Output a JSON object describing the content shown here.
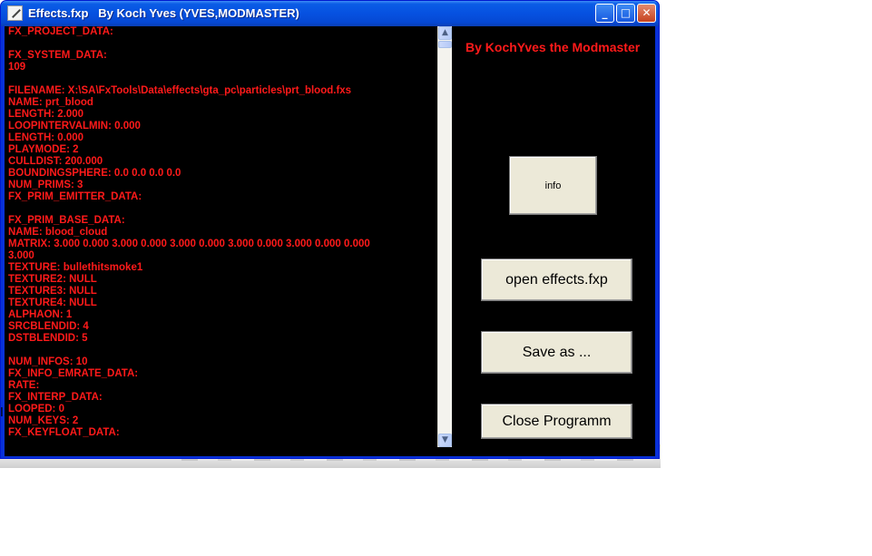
{
  "window": {
    "title": "Effects.fxp   By Koch Yves (YVES,MODMASTER)",
    "controls": {
      "minimize": "_",
      "maximize": "□",
      "close": "✕"
    }
  },
  "credit": "By KochYves the Modmaster",
  "editor_lines": [
    "FX_PROJECT_DATA:",
    "",
    "FX_SYSTEM_DATA:",
    "109",
    "",
    "FILENAME: X:\\SA\\FxTools\\Data\\effects\\gta_pc\\particles\\prt_blood.fxs",
    "NAME: prt_blood",
    "LENGTH: 2.000",
    "LOOPINTERVALMIN: 0.000",
    "LENGTH: 0.000",
    "PLAYMODE: 2",
    "CULLDIST: 200.000",
    "BOUNDINGSPHERE: 0.0 0.0 0.0 0.0",
    "NUM_PRIMS: 3",
    "FX_PRIM_EMITTER_DATA:",
    "",
    "FX_PRIM_BASE_DATA:",
    "NAME: blood_cloud",
    "MATRIX: 3.000 0.000 3.000 0.000 3.000 0.000 3.000 0.000 3.000 0.000 0.000",
    "3.000",
    "TEXTURE: bullethitsmoke1",
    "TEXTURE2: NULL",
    "TEXTURE3: NULL",
    "TEXTURE4: NULL",
    "ALPHAON: 1",
    "SRCBLENDID: 4",
    "DSTBLENDID: 5",
    "",
    "NUM_INFOS: 10",
    "FX_INFO_EMRATE_DATA:",
    "RATE:",
    "FX_INTERP_DATA:",
    "LOOPED: 0",
    "NUM_KEYS: 2",
    "FX_KEYFLOAT_DATA:"
  ],
  "scrollbar": {
    "up": "▲",
    "down": "▼"
  },
  "buttons": {
    "info": "info",
    "open": "open effects.fxp",
    "save": "Save as ...",
    "close": "Close Programm"
  },
  "colors": {
    "text": "#ff1a1a",
    "client_bg": "#000000",
    "button_face": "#ece9d8",
    "titlebar": "#0a5ce6"
  }
}
